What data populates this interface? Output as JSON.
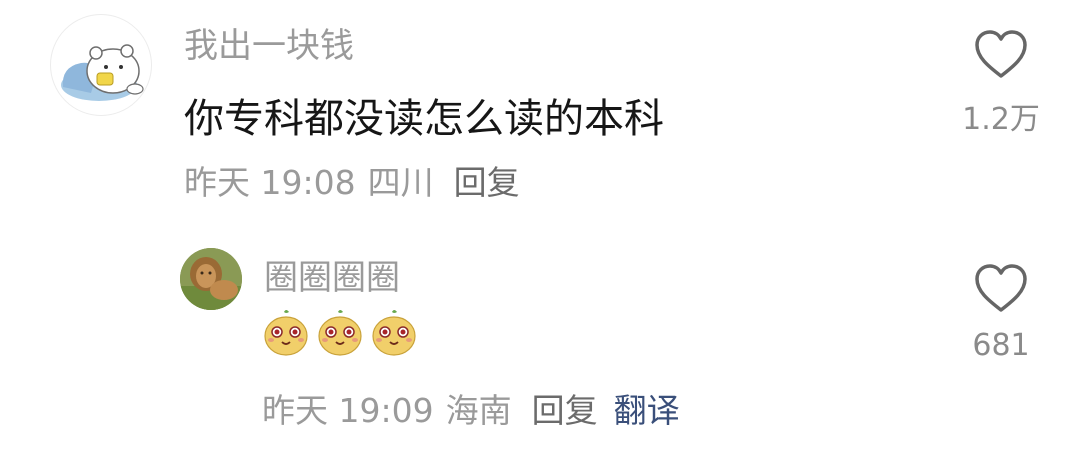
{
  "comments": [
    {
      "username": "我出一块钱",
      "content": "你专科都没读怎么读的本科",
      "time": "昨天 19:08",
      "location": "四川",
      "reply_label": "回复",
      "like_count": "1.2万"
    },
    {
      "username": "圈圈圈圈",
      "emojis": [
        "potato-face-emoji",
        "potato-face-emoji",
        "potato-face-emoji"
      ],
      "time": "昨天 19:09",
      "location": "海南",
      "reply_label": "回复",
      "translate_label": "翻译",
      "like_count": "681"
    }
  ],
  "colors": {
    "secondary_text": "#9a9a9a",
    "reply_text": "#6b6b6b",
    "translate_link": "#3a4f7a"
  }
}
